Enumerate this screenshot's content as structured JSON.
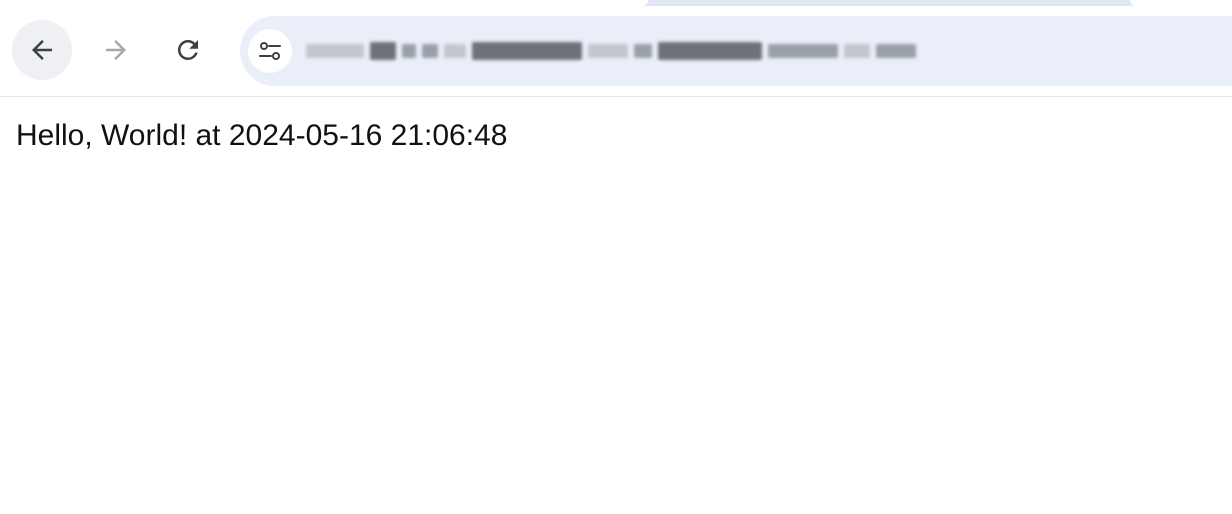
{
  "browser": {
    "nav": {
      "back_icon": "arrow-left-icon",
      "forward_icon": "arrow-right-icon",
      "reload_icon": "reload-icon"
    },
    "omnibox": {
      "site_info_icon": "site-settings-icon"
    }
  },
  "page": {
    "message": "Hello, World! at 2024-05-16 21:06:48"
  },
  "colors": {
    "omnibox_bg": "#e9eef8",
    "tabstrip_bg": "#dfe7f5",
    "icon_active": "#3c4043",
    "icon_disabled": "#a4a8ad"
  }
}
